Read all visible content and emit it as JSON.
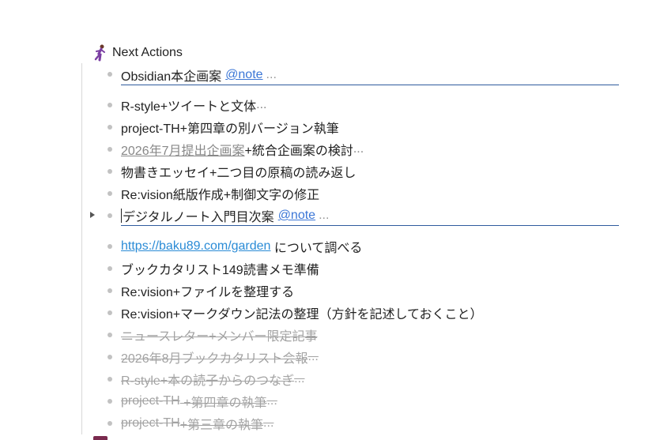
{
  "header": {
    "title": "Next Actions",
    "icon": "person-running-icon"
  },
  "items": [
    {
      "text": "Obsidian本企画案",
      "mention": "@note",
      "ellipsis": "..."
    },
    {
      "text": "R-style+ツイートと文体",
      "ellipsis": "..."
    },
    {
      "text": "project-TH+第四章の別バージョン執筆"
    },
    {
      "link": "2026年7月提出企画案",
      "text": "+統合企画案の検討",
      "ellipsis": "..."
    },
    {
      "text": "物書きエッセイ+二つ目の原稿の読み返し"
    },
    {
      "text": "Re:vision紙版作成+制御文字の修正"
    },
    {
      "text": "デジタルノート入門目次案",
      "mention": "@note",
      "ellipsis": "..."
    },
    {
      "link": "https://baku89.com/garden",
      "text": " について調べる"
    },
    {
      "text": "ブックカタリスト149読書メモ準備"
    },
    {
      "text": "Re:vision+ファイルを整理する"
    },
    {
      "text": "Re:vision+マークダウン記法の整理（方針を記述しておくこと）"
    },
    {
      "text": "ニュースレター+メンバー限定記事"
    },
    {
      "text": "2026年8月ブックカタリスト会報",
      "ellipsis": "..."
    },
    {
      "text": "R-style+本の読子からのつなぎ",
      "ellipsis": "..."
    },
    {
      "link": "project-TH",
      "text": " +第四章の執筆",
      "ellipsis": "..."
    },
    {
      "link": "project-TH",
      "text": "+第三章の執筆",
      "ellipsis": "..."
    }
  ]
}
